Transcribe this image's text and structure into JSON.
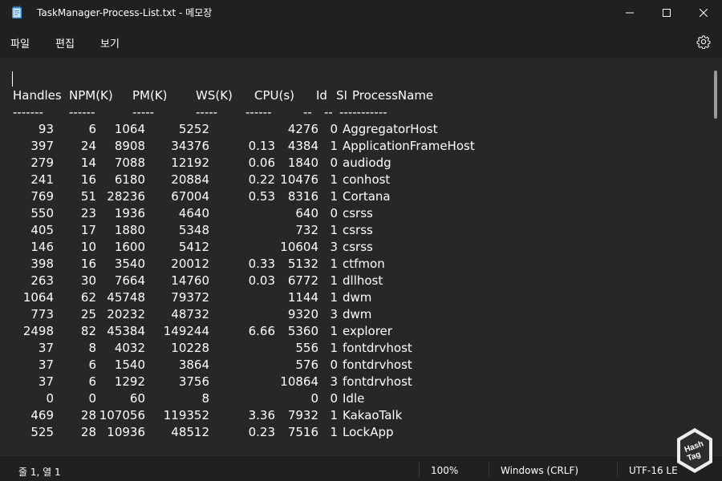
{
  "window": {
    "title": "TaskManager-Process-List.txt - 메모장",
    "icon": "notepad-icon",
    "controls": [
      "minimize-icon",
      "maximize-icon",
      "close-icon"
    ]
  },
  "menu": {
    "file": "파일",
    "edit": "편집",
    "view": "보기",
    "settings_icon": "gear-icon"
  },
  "document": {
    "header": {
      "handles": "Handles",
      "npm": "NPM(K)",
      "pm": "PM(K)",
      "ws": "WS(K)",
      "cpu": "CPU(s)",
      "id": "Id",
      "si": "SI",
      "name": "ProcessName"
    },
    "separator": {
      "handles": "-------",
      "npm": "------",
      "pm": "-----",
      "ws": "-----",
      "cpu": "------",
      "id": "--",
      "si": "--",
      "name": "-----------"
    },
    "rows": [
      {
        "handles": "93",
        "npm": "6",
        "pm": "1064",
        "ws": "5252",
        "cpu": "",
        "id": "4276",
        "si": "0",
        "name": "AggregatorHost"
      },
      {
        "handles": "397",
        "npm": "24",
        "pm": "8908",
        "ws": "34376",
        "cpu": "0.13",
        "id": "4384",
        "si": "1",
        "name": "ApplicationFrameHost"
      },
      {
        "handles": "279",
        "npm": "14",
        "pm": "7088",
        "ws": "12192",
        "cpu": "0.06",
        "id": "1840",
        "si": "0",
        "name": "audiodg"
      },
      {
        "handles": "241",
        "npm": "16",
        "pm": "6180",
        "ws": "20884",
        "cpu": "0.22",
        "id": "10476",
        "si": "1",
        "name": "conhost"
      },
      {
        "handles": "769",
        "npm": "51",
        "pm": "28236",
        "ws": "67004",
        "cpu": "0.53",
        "id": "8316",
        "si": "1",
        "name": "Cortana"
      },
      {
        "handles": "550",
        "npm": "23",
        "pm": "1936",
        "ws": "4640",
        "cpu": "",
        "id": "640",
        "si": "0",
        "name": "csrss"
      },
      {
        "handles": "405",
        "npm": "17",
        "pm": "1880",
        "ws": "5348",
        "cpu": "",
        "id": "732",
        "si": "1",
        "name": "csrss"
      },
      {
        "handles": "146",
        "npm": "10",
        "pm": "1600",
        "ws": "5412",
        "cpu": "",
        "id": "10604",
        "si": "3",
        "name": "csrss"
      },
      {
        "handles": "398",
        "npm": "16",
        "pm": "3540",
        "ws": "20012",
        "cpu": "0.33",
        "id": "5132",
        "si": "1",
        "name": "ctfmon"
      },
      {
        "handles": "263",
        "npm": "30",
        "pm": "7664",
        "ws": "14760",
        "cpu": "0.03",
        "id": "6772",
        "si": "1",
        "name": "dllhost"
      },
      {
        "handles": "1064",
        "npm": "62",
        "pm": "45748",
        "ws": "79372",
        "cpu": "",
        "id": "1144",
        "si": "1",
        "name": "dwm"
      },
      {
        "handles": "773",
        "npm": "25",
        "pm": "20232",
        "ws": "48732",
        "cpu": "",
        "id": "9320",
        "si": "3",
        "name": "dwm"
      },
      {
        "handles": "2498",
        "npm": "82",
        "pm": "45384",
        "ws": "149244",
        "cpu": "6.66",
        "id": "5360",
        "si": "1",
        "name": "explorer"
      },
      {
        "handles": "37",
        "npm": "8",
        "pm": "4032",
        "ws": "10228",
        "cpu": "",
        "id": "556",
        "si": "1",
        "name": "fontdrvhost"
      },
      {
        "handles": "37",
        "npm": "6",
        "pm": "1540",
        "ws": "3864",
        "cpu": "",
        "id": "576",
        "si": "0",
        "name": "fontdrvhost"
      },
      {
        "handles": "37",
        "npm": "6",
        "pm": "1292",
        "ws": "3756",
        "cpu": "",
        "id": "10864",
        "si": "3",
        "name": "fontdrvhost"
      },
      {
        "handles": "0",
        "npm": "0",
        "pm": "60",
        "ws": "8",
        "cpu": "",
        "id": "0",
        "si": "0",
        "name": "Idle"
      },
      {
        "handles": "469",
        "npm": "28",
        "pm": "107056",
        "ws": "119352",
        "cpu": "3.36",
        "id": "7932",
        "si": "1",
        "name": "KakaoTalk"
      },
      {
        "handles": "525",
        "npm": "28",
        "pm": "10936",
        "ws": "48512",
        "cpu": "0.23",
        "id": "7516",
        "si": "1",
        "name": "LockApp"
      }
    ]
  },
  "status": {
    "position": "줄 1, 열 1",
    "zoom": "100%",
    "line_ending": "Windows (CRLF)",
    "encoding": "UTF-16 LE"
  },
  "watermark": {
    "text_1": "Hash",
    "text_2": "Tag"
  }
}
